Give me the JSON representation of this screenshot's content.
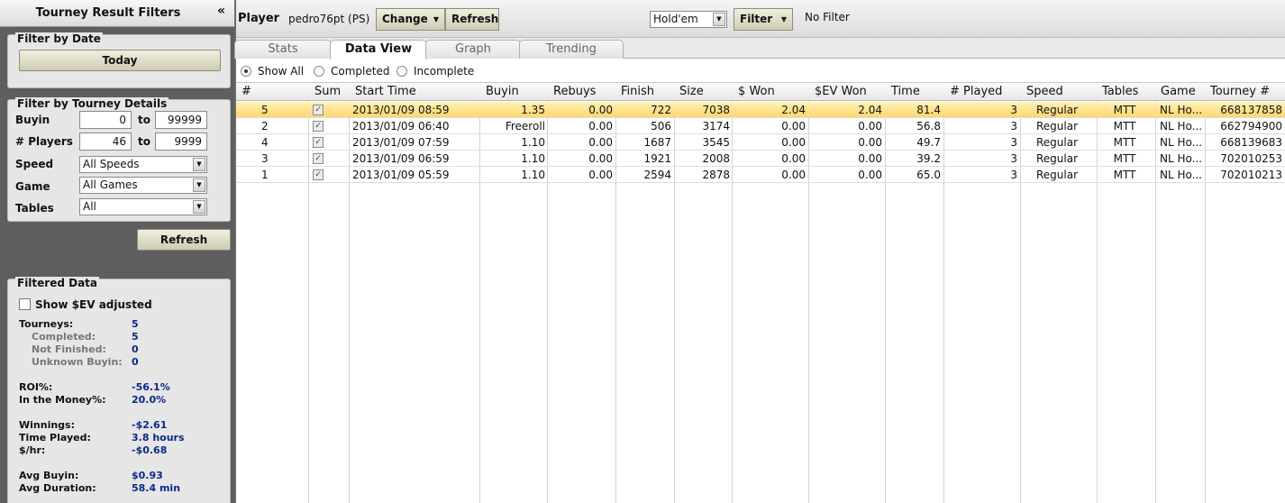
{
  "sidebar": {
    "title": "Tourney Result Filters",
    "collapse": "«",
    "date_panel": {
      "title": "Filter by Date",
      "today_label": "Today"
    },
    "details_panel": {
      "title": "Filter by Tourney Details",
      "buyin_label": "Buyin",
      "buyin_min": "0",
      "to1": "to",
      "buyin_max": "99999",
      "players_label": "# Players",
      "players_min": "46",
      "to2": "to",
      "players_max": "9999",
      "speed_label": "Speed",
      "speed_value": "All Speeds",
      "game_label": "Game",
      "game_value": "All Games",
      "tables_label": "Tables",
      "tables_value": "All"
    },
    "refresh_label": "Refresh",
    "data_panel": {
      "title": "Filtered Data",
      "ev_label": "Show $EV adjusted",
      "stats": [
        {
          "label": "Tourneys:",
          "value": "5"
        },
        {
          "label": "Completed:",
          "value": "5"
        },
        {
          "label": "Not Finished:",
          "value": "0"
        },
        {
          "label": "Unknown Buyin:",
          "value": "0"
        },
        {
          "label": "ROI%:",
          "value": "-56.1%"
        },
        {
          "label": "In the Money%:",
          "value": "20.0%"
        },
        {
          "label": "Winnings:",
          "value": "-$2.61"
        },
        {
          "label": "Time Played:",
          "value": "3.8 hours"
        },
        {
          "label": "$/hr:",
          "value": "-$0.68"
        },
        {
          "label": "Avg Buyin:",
          "value": "$0.93"
        },
        {
          "label": "Avg Duration:",
          "value": "58.4 min"
        }
      ]
    }
  },
  "topbar": {
    "player_label": "Player",
    "player_name": "pedro76pt (PS)",
    "change_label": "Change",
    "refresh_label": "Refresh",
    "game_value": "Hold'em",
    "filter_label": "Filter",
    "filter_status": "No Filter"
  },
  "tabs": [
    {
      "label": "Stats"
    },
    {
      "label": "Data View"
    },
    {
      "label": "Graph"
    },
    {
      "label": "Trending"
    }
  ],
  "view_options": [
    "Show All",
    "Completed",
    "Incomplete"
  ],
  "table": {
    "columns": [
      "#",
      "Sum",
      "Start Time",
      "Buyin",
      "Rebuys",
      "Finish",
      "Size",
      "$ Won",
      "$EV Won",
      "Time",
      "# Played",
      "Speed",
      "Tables",
      "Game",
      "Tourney #"
    ],
    "rows": [
      [
        "5",
        "",
        "2013/01/09 08:59",
        "1.35",
        "0.00",
        "722",
        "7038",
        "2.04",
        "2.04",
        "81.4",
        "3",
        "Regular",
        "MTT",
        "NL Ho...",
        "668137858"
      ],
      [
        "2",
        "",
        "2013/01/09 06:40",
        "Freeroll",
        "0.00",
        "506",
        "3174",
        "0.00",
        "0.00",
        "56.8",
        "3",
        "Regular",
        "MTT",
        "NL Ho...",
        "662794900"
      ],
      [
        "4",
        "",
        "2013/01/09 07:59",
        "1.10",
        "0.00",
        "1687",
        "3545",
        "0.00",
        "0.00",
        "49.7",
        "3",
        "Regular",
        "MTT",
        "NL Ho...",
        "668139683"
      ],
      [
        "3",
        "",
        "2013/01/09 06:59",
        "1.10",
        "0.00",
        "1921",
        "2008",
        "0.00",
        "0.00",
        "39.2",
        "3",
        "Regular",
        "MTT",
        "NL Ho...",
        "702010253"
      ],
      [
        "1",
        "",
        "2013/01/09 05:59",
        "1.10",
        "0.00",
        "2594",
        "2878",
        "0.00",
        "0.00",
        "65.0",
        "3",
        "Regular",
        "MTT",
        "NL Ho...",
        "702010213"
      ]
    ]
  }
}
